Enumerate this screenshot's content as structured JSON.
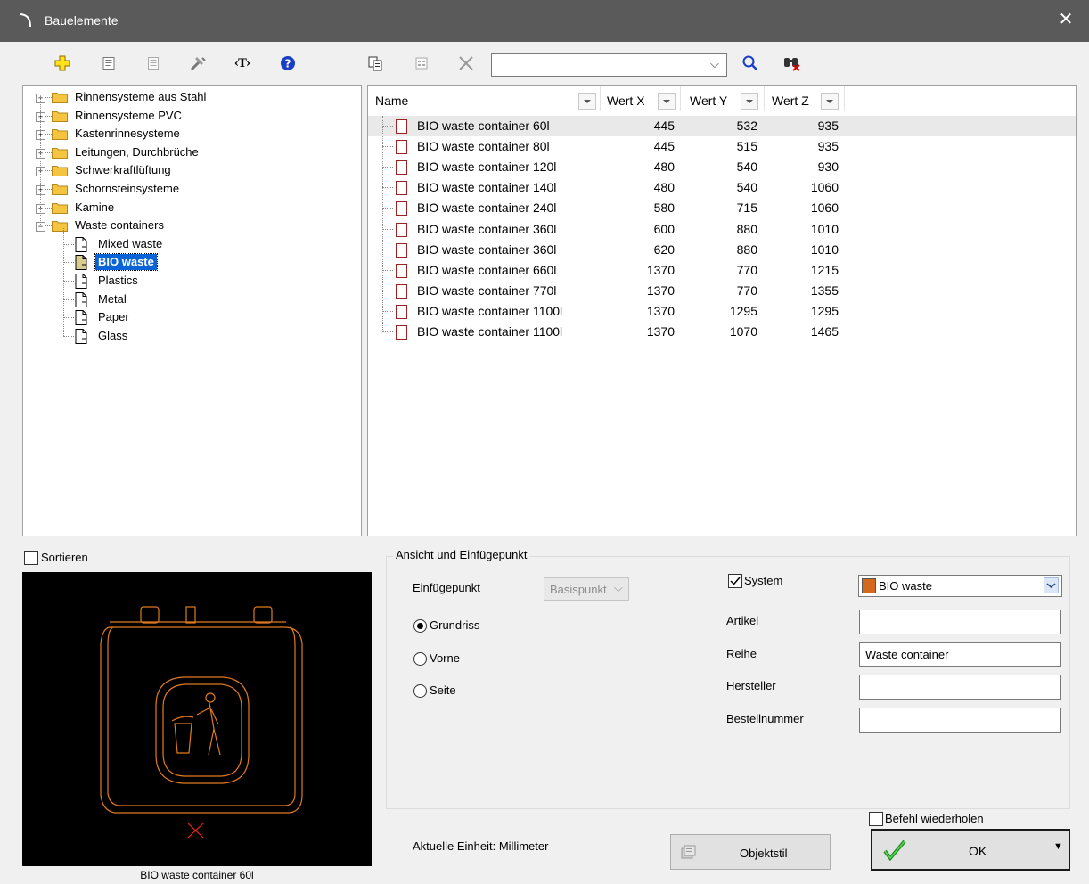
{
  "window": {
    "title": "Bauelemente"
  },
  "toolbar": {
    "icons": [
      "add-icon",
      "properties-icon",
      "list-icon",
      "tools-icon",
      "text-icon",
      "help-icon",
      "copy-icon",
      "table-icon",
      "delete-icon"
    ],
    "search_value": "",
    "search_icon": "search-icon",
    "find_icon": "binoculars-icon"
  },
  "tree": {
    "folders": [
      {
        "label": "Rinnensysteme aus Stahl",
        "expanded": false
      },
      {
        "label": "Rinnensysteme PVC",
        "expanded": false
      },
      {
        "label": "Kastenrinnesysteme",
        "expanded": false
      },
      {
        "label": "Leitungen, Durchbrüche",
        "expanded": false
      },
      {
        "label": "Schwerkraftlüftung",
        "expanded": false
      },
      {
        "label": "Schornsteinsysteme",
        "expanded": false
      },
      {
        "label": "Kamine",
        "expanded": false
      },
      {
        "label": "Waste containers",
        "expanded": true
      }
    ],
    "children": [
      {
        "label": "Mixed waste",
        "selected": false
      },
      {
        "label": "BIO waste",
        "selected": true
      },
      {
        "label": "Plastics",
        "selected": false
      },
      {
        "label": "Metal",
        "selected": false
      },
      {
        "label": "Paper",
        "selected": false
      },
      {
        "label": "Glass",
        "selected": false
      }
    ]
  },
  "table": {
    "columns": [
      "Name",
      "Wert X",
      "Wert Y",
      "Wert Z"
    ],
    "rows": [
      {
        "name": "BIO waste container 60l",
        "x": "445",
        "y": "532",
        "z": "935"
      },
      {
        "name": "BIO waste container 80l",
        "x": "445",
        "y": "515",
        "z": "935"
      },
      {
        "name": "BIO waste container 120l",
        "x": "480",
        "y": "540",
        "z": "930"
      },
      {
        "name": "BIO waste container 140l",
        "x": "480",
        "y": "540",
        "z": "1060"
      },
      {
        "name": "BIO waste container 240l",
        "x": "580",
        "y": "715",
        "z": "1060"
      },
      {
        "name": "BIO waste container 360l",
        "x": "600",
        "y": "880",
        "z": "1010"
      },
      {
        "name": "BIO waste container 360l",
        "x": "620",
        "y": "880",
        "z": "1010"
      },
      {
        "name": "BIO waste container 660l",
        "x": "1370",
        "y": "770",
        "z": "1215"
      },
      {
        "name": "BIO waste container 770l",
        "x": "1370",
        "y": "770",
        "z": "1355"
      },
      {
        "name": "BIO waste container 1100l",
        "x": "1370",
        "y": "1295",
        "z": "1295"
      },
      {
        "name": "BIO waste container 1100l",
        "x": "1370",
        "y": "1070",
        "z": "1465"
      }
    ]
  },
  "preview": {
    "sort_label": "Sortieren",
    "sort_checked": false,
    "caption": "BIO waste container 60l"
  },
  "insert": {
    "group_label": "Ansicht und Einfügepunkt",
    "insertpoint_label": "Einfügepunkt",
    "insertpoint_value": "Basispunkt",
    "radios": [
      {
        "label": "Grundriss",
        "checked": true
      },
      {
        "label": "Vorne",
        "checked": false
      },
      {
        "label": "Seite",
        "checked": false
      }
    ],
    "system_label": "System",
    "system_checked": true,
    "system_value": "BIO waste",
    "system_color": "#d2691e",
    "artikel_label": "Artikel",
    "artikel_value": "",
    "reihe_label": "Reihe",
    "reihe_value": "Waste container",
    "hersteller_label": "Hersteller",
    "hersteller_value": "",
    "bestell_label": "Bestellnummer",
    "bestell_value": ""
  },
  "footer": {
    "unit_text": "Aktuelle Einheit: Millimeter",
    "objektstil_label": "Objektstil",
    "repeat_label": "Befehl wiederholen",
    "repeat_checked": false,
    "ok_label": "OK"
  }
}
